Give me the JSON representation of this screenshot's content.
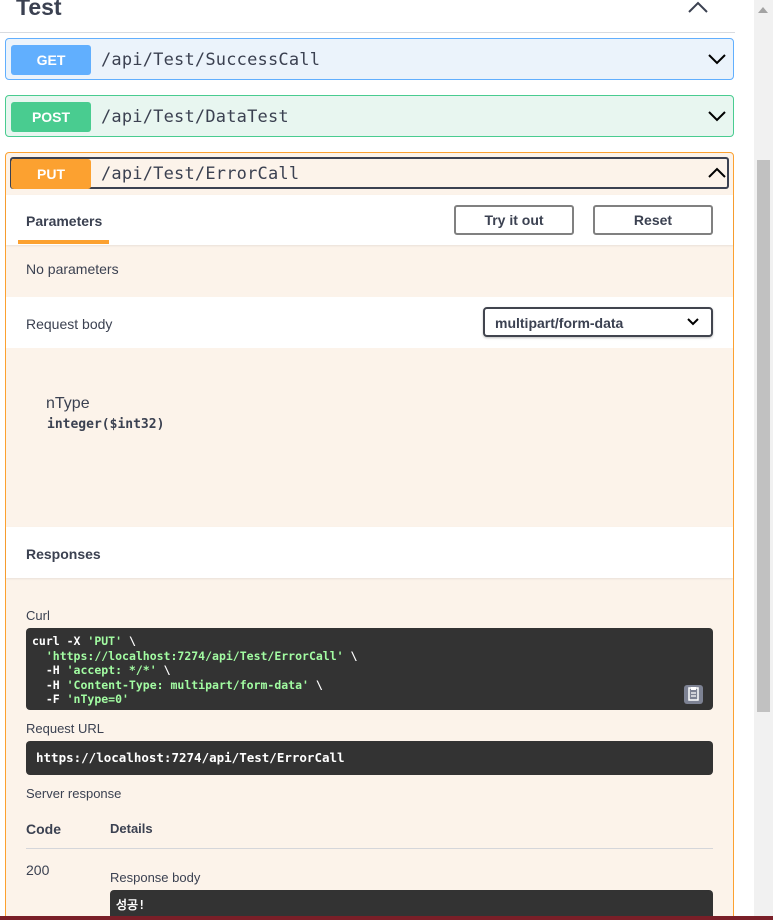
{
  "tag": {
    "title": "Test"
  },
  "operations": {
    "get": {
      "method": "GET",
      "path": "/api/Test/SuccessCall"
    },
    "post": {
      "method": "POST",
      "path": "/api/Test/DataTest"
    },
    "put": {
      "method": "PUT",
      "path": "/api/Test/ErrorCall"
    }
  },
  "parameters": {
    "tab_label": "Parameters",
    "try_it_out_label": "Try it out",
    "reset_label": "Reset",
    "no_params_text": "No parameters"
  },
  "request_body": {
    "label": "Request body",
    "content_type": "multipart/form-data",
    "param_name": "nType",
    "param_type": "integer",
    "param_format": "($int32)"
  },
  "responses": {
    "label": "Responses",
    "curl_label": "Curl",
    "curl_lines": [
      {
        "pre": "curl -X ",
        "str": "'PUT'",
        "post": " \\"
      },
      {
        "pre": "  ",
        "str": "'https://localhost:7274/api/Test/ErrorCall'",
        "post": " \\"
      },
      {
        "pre": "  -H ",
        "str": "'accept: */*'",
        "post": " \\"
      },
      {
        "pre": "  -H ",
        "str": "'Content-Type: multipart/form-data'",
        "post": " \\"
      },
      {
        "pre": "  -F ",
        "str": "'nType=0'",
        "post": ""
      }
    ],
    "request_url_label": "Request URL",
    "request_url": "https://localhost:7274/api/Test/ErrorCall",
    "server_response_label": "Server response",
    "code_col": "Code",
    "details_col": "Details",
    "code_value": "200",
    "response_body_label": "Response body",
    "response_body": "성공!"
  },
  "colors": {
    "get": "#61affe",
    "post": "#49cc90",
    "put": "#fca130",
    "code_bg": "#333333"
  }
}
